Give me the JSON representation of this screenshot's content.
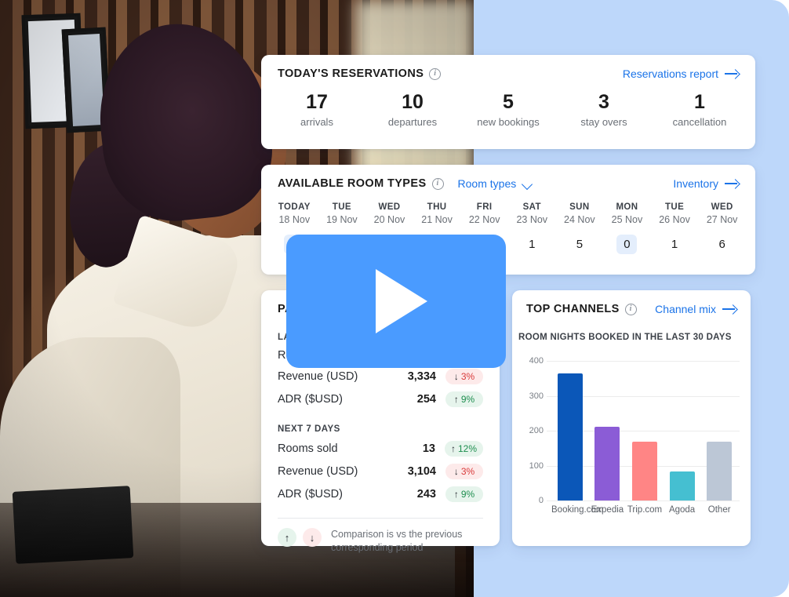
{
  "reservations": {
    "title": "TODAY'S RESERVATIONS",
    "info_icon": "info-icon",
    "link_label": "Reservations report",
    "stats": [
      {
        "num": "17",
        "label": "arrivals"
      },
      {
        "num": "10",
        "label": "departures"
      },
      {
        "num": "5",
        "label": "new bookings"
      },
      {
        "num": "3",
        "label": "stay overs"
      },
      {
        "num": "1",
        "label": "cancellation"
      }
    ]
  },
  "room_types": {
    "title": "AVAILABLE ROOM TYPES",
    "info_icon": "info-icon",
    "selector_label": "Room types",
    "selector_icon": "chevron-down-icon",
    "link_label": "Inventory",
    "days": [
      {
        "dow": "TODAY",
        "date": "18 Nov",
        "value": "",
        "highlight": true
      },
      {
        "dow": "TUE",
        "date": "19 Nov",
        "value": "",
        "highlight": false
      },
      {
        "dow": "WED",
        "date": "20 Nov",
        "value": "",
        "highlight": false
      },
      {
        "dow": "THU",
        "date": "21 Nov",
        "value": "",
        "highlight": false
      },
      {
        "dow": "FRI",
        "date": "22 Nov",
        "value": "",
        "highlight": false
      },
      {
        "dow": "SAT",
        "date": "23 Nov",
        "value": "1",
        "highlight": false
      },
      {
        "dow": "SUN",
        "date": "24 Nov",
        "value": "5",
        "highlight": false
      },
      {
        "dow": "MON",
        "date": "25 Nov",
        "value": "0",
        "highlight": true
      },
      {
        "dow": "TUE",
        "date": "26 Nov",
        "value": "1",
        "highlight": false
      },
      {
        "dow": "WED",
        "date": "27 Nov",
        "value": "6",
        "highlight": false
      }
    ]
  },
  "pace": {
    "title": "PA",
    "section_last": "LAS",
    "section_next": "NEXT 7 DAYS",
    "last_rows": [
      {
        "name": "Roo",
        "value": "",
        "delta": "",
        "dir": ""
      },
      {
        "name": "Revenue (USD)",
        "value": "3,334",
        "delta": "3%",
        "dir": "down"
      },
      {
        "name": "ADR ($USD)",
        "value": "254",
        "delta": "9%",
        "dir": "up"
      }
    ],
    "next_rows": [
      {
        "name": "Rooms sold",
        "value": "13",
        "delta": "12%",
        "dir": "up"
      },
      {
        "name": "Revenue (USD)",
        "value": "3,104",
        "delta": "3%",
        "dir": "down"
      },
      {
        "name": "ADR ($USD)",
        "value": "243",
        "delta": "9%",
        "dir": "up"
      }
    ],
    "footnote": "Comparison is vs the previous corresponding period",
    "up_arrow": "↑",
    "down_arrow": "↓"
  },
  "channels": {
    "title": "TOP CHANNELS",
    "info_icon": "info-icon",
    "link_label": "Channel mix"
  },
  "chart_data": {
    "type": "bar",
    "title": "ROOM NIGHTS BOOKED IN THE LAST 30 DAYS",
    "categories": [
      "Booking.com",
      "Expedia",
      "Trip.com",
      "Agoda",
      "Other"
    ],
    "values": [
      365,
      212,
      168,
      84,
      168
    ],
    "colors": [
      "#0b57b8",
      "#8b5cd6",
      "#ff8585",
      "#45bfd1",
      "#bcc7d6"
    ],
    "ylabel": "",
    "xlabel": "",
    "ylim": [
      0,
      400
    ],
    "yticks": [
      0,
      100,
      200,
      300,
      400
    ],
    "grid": true,
    "legend": "none"
  },
  "video": {
    "play_icon": "play-icon",
    "accent": "#4a9bff"
  },
  "theme": {
    "page_bg": "#bdd7fa",
    "link_color": "#1a73e8",
    "up_color": "#1e8e4f",
    "down_color": "#d93a3a",
    "highlight_bg": "#e4eefc"
  }
}
